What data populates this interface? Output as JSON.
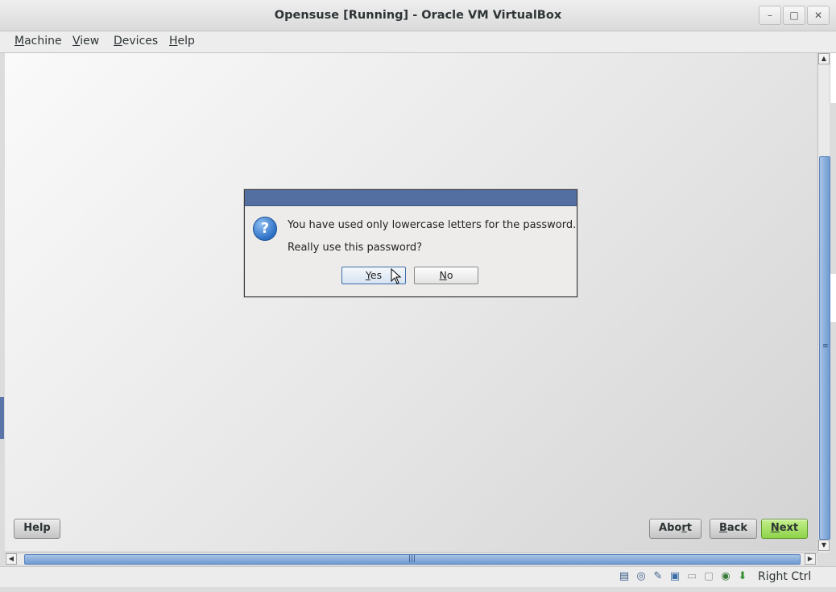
{
  "window": {
    "title": "Opensuse [Running] - Oracle VM VirtualBox"
  },
  "menu": [
    {
      "key": "M",
      "rest": "achine"
    },
    {
      "key": "V",
      "rest": "iew"
    },
    {
      "key": "D",
      "rest": "evices"
    },
    {
      "key": "H",
      "rest": "elp"
    }
  ],
  "dialog": {
    "message": "You have used only lowercase letters for the password.",
    "question": "Really use this password?",
    "yes_key": "Y",
    "yes_rest": "es",
    "no_key": "N",
    "no_rest": "o"
  },
  "guest_buttons": {
    "help": "Help",
    "abort_pre": "Abo",
    "abort_key": "r",
    "abort_post": "t",
    "back_key": "B",
    "back_rest": "ack",
    "next_key": "N",
    "next_rest": "ext"
  },
  "status": {
    "host_key": "Right Ctrl"
  },
  "icons": [
    "hard-disk-icon",
    "optical-drive-icon",
    "usb-icon",
    "network-icon",
    "shared-folder-icon",
    "display-icon",
    "capture-icon",
    "arrow-down-icon"
  ]
}
